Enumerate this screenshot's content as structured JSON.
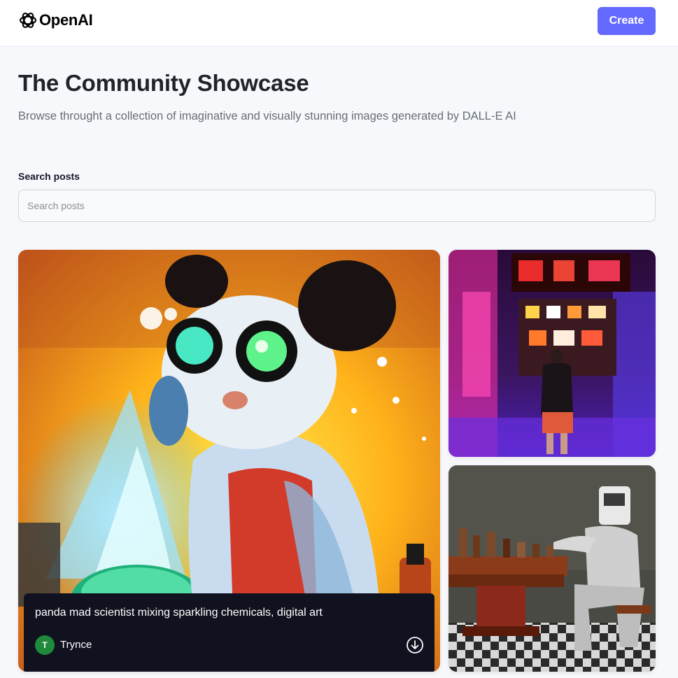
{
  "header": {
    "logo_text": "OpenAI",
    "logo_icon": "openai-logo-icon",
    "create_label": "Create"
  },
  "hero": {
    "title": "The Community Showcase",
    "subtitle": "Browse throught a collection of imaginative and visually stunning images generated by DALL-E AI"
  },
  "search": {
    "label": "Search posts",
    "placeholder": "Search posts",
    "value": ""
  },
  "posts": [
    {
      "prompt": "panda mad scientist mixing sparkling chemicals, digital art",
      "author": "Trynce",
      "author_initial": "T",
      "download_icon": "download-icon"
    },
    {
      "prompt": "",
      "author": ""
    },
    {
      "prompt": "",
      "author": ""
    }
  ],
  "colors": {
    "accent": "#6469ff",
    "avatar": "#1f8a3b",
    "overlay": "#10131f",
    "page_bg": "#f7f8fc"
  }
}
